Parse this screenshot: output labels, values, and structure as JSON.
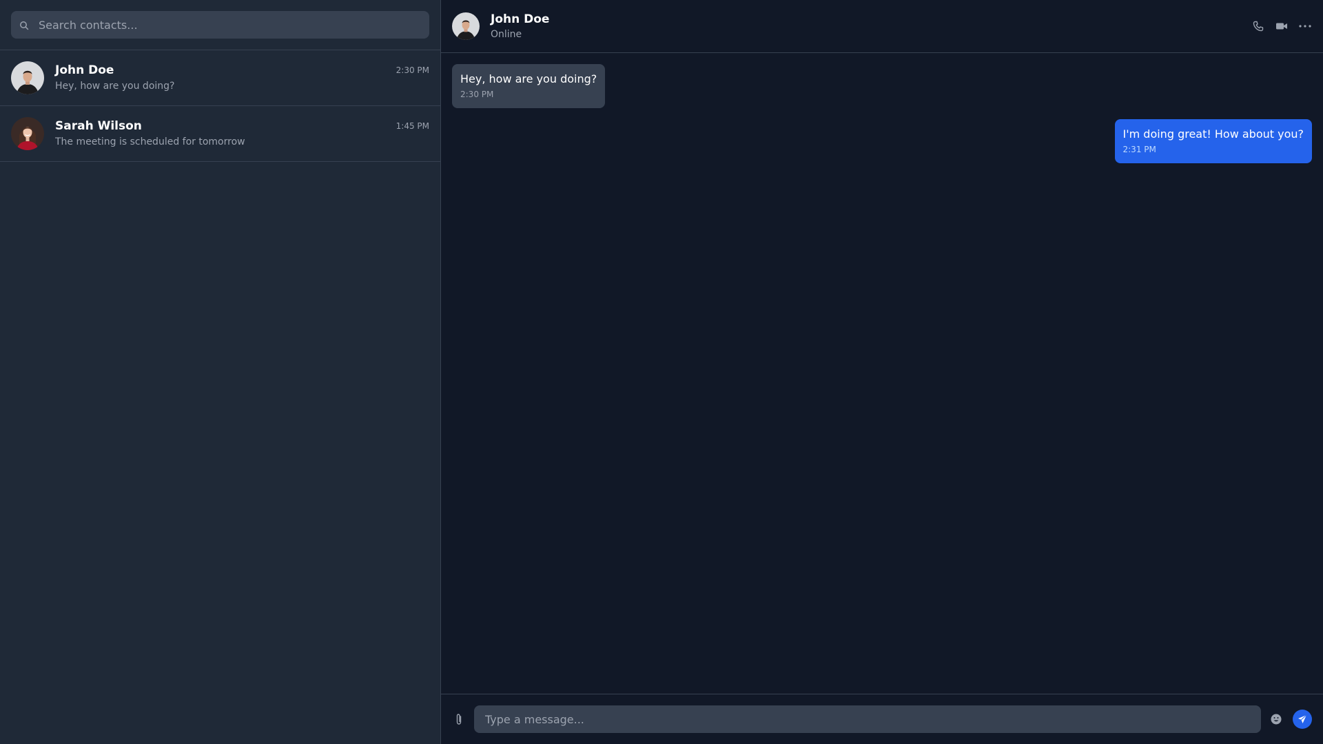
{
  "sidebar": {
    "search": {
      "placeholder": "Search contacts...",
      "value": "",
      "icon": "search-icon"
    },
    "contacts": [
      {
        "name": "John Doe",
        "time": "2:30 PM",
        "preview": "Hey, how are you doing?",
        "avatar": "avatar-john"
      },
      {
        "name": "Sarah Wilson",
        "time": "1:45 PM",
        "preview": "The meeting is scheduled for tomorrow",
        "avatar": "avatar-sarah"
      }
    ]
  },
  "chat": {
    "header": {
      "name": "John Doe",
      "status": "Online",
      "actions": [
        "phone-icon",
        "video-icon",
        "more-icon"
      ]
    },
    "messages": [
      {
        "direction": "incoming",
        "text": "Hey, how are you doing?",
        "time": "2:30 PM"
      },
      {
        "direction": "outgoing",
        "text": "I'm doing great! How about you?",
        "time": "2:31 PM"
      }
    ],
    "composer": {
      "placeholder": "Type a message...",
      "value": "",
      "icons": [
        "paperclip-icon",
        "emoji-icon",
        "send-icon"
      ]
    }
  },
  "colors": {
    "background": "#111827",
    "sidebar": "#1f2937",
    "input": "#374151",
    "accent": "#2563eb",
    "muted_text": "#9ca3af"
  }
}
